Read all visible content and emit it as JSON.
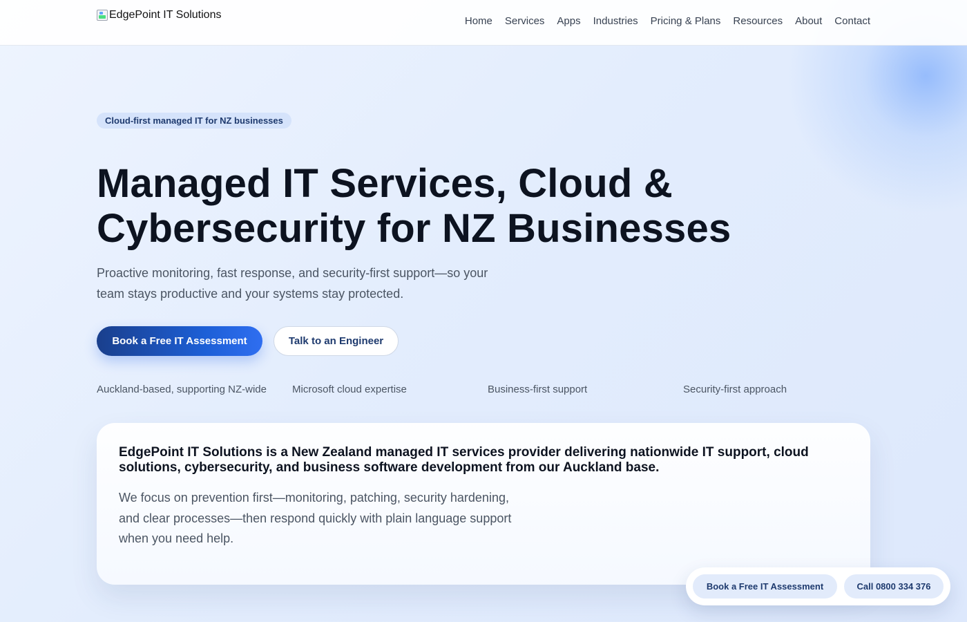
{
  "header": {
    "logo_text": "EdgePoint IT Solutions",
    "nav": [
      "Home",
      "Services",
      "Apps",
      "Industries",
      "Pricing & Plans",
      "Resources",
      "About",
      "Contact"
    ]
  },
  "hero": {
    "badge": "Cloud-first managed IT for NZ businesses",
    "title_line1": "Managed IT Services, Cloud &",
    "title_line2": "Cybersecurity for NZ Businesses",
    "subtitle": "Proactive monitoring, fast response, and security-first support—so your team stays productive and your systems stay protected.",
    "primary_cta": "Book a Free IT Assessment",
    "secondary_cta": "Talk to an Engineer",
    "features": [
      "Auckland-based, supporting NZ-wide",
      "Microsoft cloud expertise",
      "Business-first support",
      "Security-first approach"
    ]
  },
  "intro_card": {
    "title": "EdgePoint IT Solutions is a New Zealand managed IT services provider delivering nationwide IT support, cloud solutions, cybersecurity, and business software development from our Auckland base.",
    "body": "We focus on prevention first—monitoring, patching, security hardening, and clear processes—then respond quickly with plain language support when you need help."
  },
  "floating_cta": {
    "assessment": "Book a Free IT Assessment",
    "call": "Call 0800 334 376"
  },
  "colors": {
    "primary": "#1d5fd6",
    "primary_dark": "#1a3f8c",
    "text_dark": "#0d1320",
    "text_muted": "#4b5563",
    "badge_bg": "#d5e3fb"
  }
}
